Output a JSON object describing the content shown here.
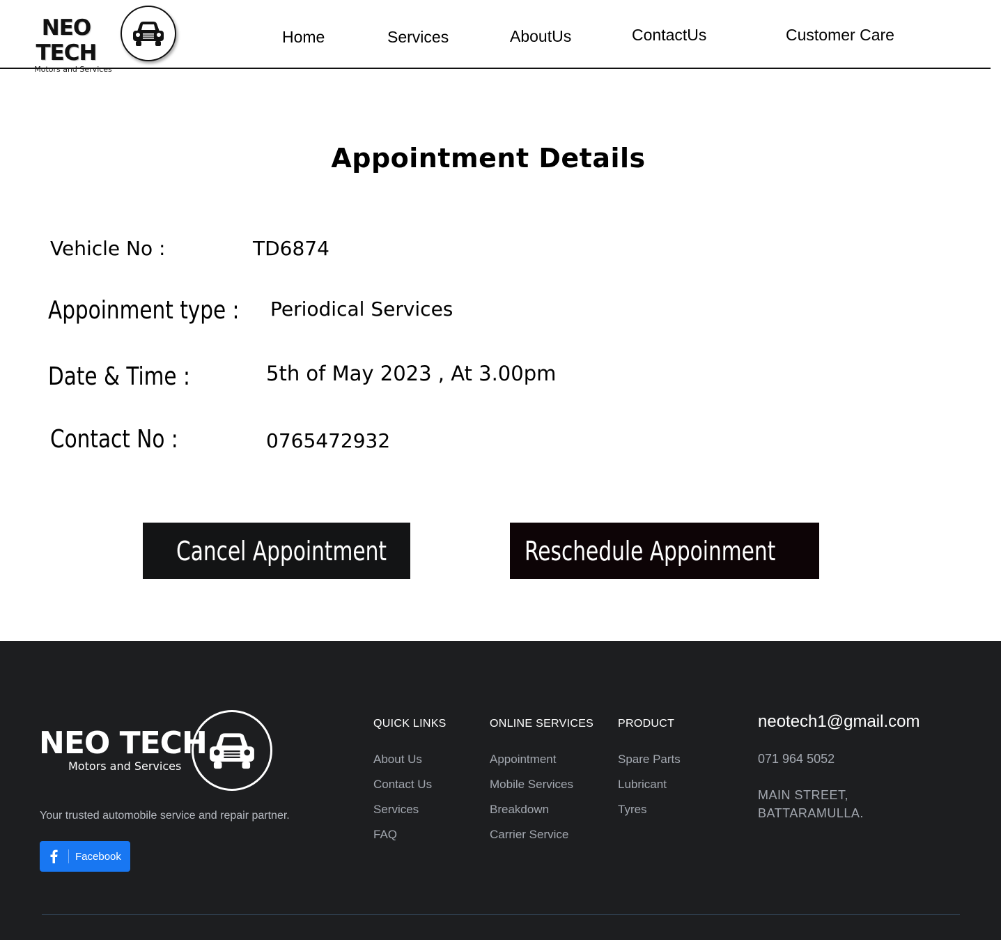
{
  "brand": {
    "name": "NEO TECH",
    "tagline": "Motors and Services",
    "logo_icon": "car-icon"
  },
  "nav": {
    "items": [
      "Home",
      "Services",
      "AboutUs",
      "ContactUs",
      "Customer Care"
    ]
  },
  "main": {
    "title": "Appointment Details",
    "fields": {
      "vehicle_label": "Vehicle No :",
      "vehicle_value": "TD6874",
      "type_label": "Appoinment type :",
      "type_value": "Periodical Services",
      "datetime_label": "Date & Time :",
      "datetime_value": "5th of May 2023 , At 3.00pm",
      "contact_label": "Contact No :",
      "contact_value": "0765472932"
    },
    "buttons": {
      "cancel": "Cancel Appointment",
      "reschedule": "Reschedule  Appoinment"
    }
  },
  "footer": {
    "brand_name": "NEO TECH",
    "brand_sub": "Motors and Services",
    "description": "Your trusted automobile service and repair partner.",
    "facebook_label": "Facebook",
    "quick_links": {
      "title": "QUICK LINKS",
      "items": [
        "About Us",
        "Contact Us",
        "Services",
        "FAQ"
      ]
    },
    "online_services": {
      "title": "ONLINE SERVICES",
      "items": [
        "Appointment",
        "Mobile Services",
        "Breakdown",
        "Carrier Service"
      ]
    },
    "product": {
      "title": "PRODUCT",
      "items": [
        "Spare Parts",
        "Lubricant",
        "Tyres"
      ]
    },
    "contact": {
      "email": "neotech1@gmail.com",
      "phone": "071 964 5052",
      "address_line1": "MAIN STREET,",
      "address_line2": "BATTARAMULLA."
    }
  },
  "colors": {
    "footer_bg": "#1d1e20",
    "button_bg": "#131415",
    "facebook_blue": "#1877f2",
    "footer_link": "#a3a8b0"
  }
}
